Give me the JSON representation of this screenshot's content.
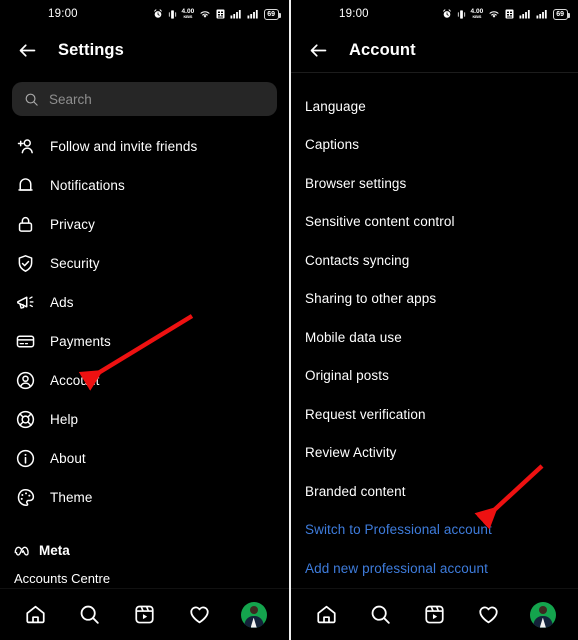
{
  "statusbar": {
    "time": "19:00",
    "network_speed_value": "4.00",
    "network_speed_unit": "KB/S",
    "battery_level": "69",
    "icons": [
      "alarm-icon",
      "vibrate-icon",
      "network-speed-icon",
      "wifi-icon",
      "sim-icon",
      "signal-1-icon",
      "signal-2-icon",
      "battery-icon"
    ]
  },
  "colors": {
    "background": "#000000",
    "text": "#ffffff",
    "link_blue": "#3e7cdc",
    "search_field": "#262626",
    "placeholder": "#8e8e8e",
    "arrow_red": "#ee1111",
    "avatar_ring": "#14a44d"
  },
  "settings_screen": {
    "title": "Settings",
    "back_icon": "arrow-left-icon",
    "search": {
      "placeholder": "Search",
      "value": "",
      "icon": "search-icon"
    },
    "items": [
      {
        "label": "Follow and invite friends",
        "icon": "person-add-icon"
      },
      {
        "label": "Notifications",
        "icon": "bell-icon"
      },
      {
        "label": "Privacy",
        "icon": "lock-icon"
      },
      {
        "label": "Security",
        "icon": "shield-check-icon"
      },
      {
        "label": "Ads",
        "icon": "megaphone-icon"
      },
      {
        "label": "Payments",
        "icon": "credit-card-icon"
      },
      {
        "label": "Account",
        "icon": "account-circle-icon"
      },
      {
        "label": "Help",
        "icon": "lifebuoy-icon"
      },
      {
        "label": "About",
        "icon": "info-circle-icon"
      },
      {
        "label": "Theme",
        "icon": "palette-icon"
      }
    ],
    "footer": {
      "brand": "Meta",
      "brand_icon": "meta-infinity-icon",
      "accounts_centre": "Accounts Centre"
    }
  },
  "account_screen": {
    "title": "Account",
    "back_icon": "arrow-left-icon",
    "items": [
      {
        "label": "Language",
        "style": "normal"
      },
      {
        "label": "Captions",
        "style": "normal"
      },
      {
        "label": "Browser settings",
        "style": "normal"
      },
      {
        "label": "Sensitive content control",
        "style": "normal"
      },
      {
        "label": "Contacts syncing",
        "style": "normal"
      },
      {
        "label": "Sharing to other apps",
        "style": "normal"
      },
      {
        "label": "Mobile data use",
        "style": "normal"
      },
      {
        "label": "Original posts",
        "style": "normal"
      },
      {
        "label": "Request verification",
        "style": "normal"
      },
      {
        "label": "Review Activity",
        "style": "normal"
      },
      {
        "label": "Branded content",
        "style": "normal"
      },
      {
        "label": "Switch to Professional account",
        "style": "link"
      },
      {
        "label": "Add new professional account",
        "style": "link"
      }
    ]
  },
  "bottom_nav": {
    "items": [
      {
        "icon": "home-icon",
        "name": "home"
      },
      {
        "icon": "search-icon",
        "name": "search"
      },
      {
        "icon": "reels-icon",
        "name": "reels"
      },
      {
        "icon": "heart-icon",
        "name": "activity"
      },
      {
        "icon": "profile-avatar",
        "name": "profile"
      }
    ]
  },
  "annotations": [
    {
      "name": "arrow-pointing-to-account",
      "target": "Account",
      "panel": "settings"
    },
    {
      "name": "arrow-pointing-to-switch-professional",
      "target": "Switch to Professional account",
      "panel": "account"
    }
  ]
}
